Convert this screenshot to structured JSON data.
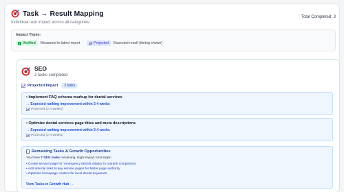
{
  "header": {
    "title": "Task → Result Mapping",
    "subtitle": "Individual task impact across all categories",
    "total_label": "Total Completed:",
    "total_value": "3"
  },
  "impact_types": {
    "label": "Impact Types:",
    "verified_badge": "Verified",
    "verified_desc": "Measured in latest report",
    "projected_badge": "Projected",
    "projected_desc": "Expected result (timing shown)"
  },
  "seo": {
    "title": "SEO",
    "subtitle": "2 tasks completed",
    "projected_label": "Projected Impact",
    "projected_count": "2 tasks",
    "tasks": [
      {
        "title": "• Implement FAQ schema markup for dental services",
        "result": "→ Expected ranking improvement within 2-4 weeks",
        "timing": "Projected (2-4 weeks)"
      },
      {
        "title": "• Optimize dental services page titles and meta descriptions",
        "result": "→ Expected ranking improvement within 2-4 weeks",
        "timing": "Projected (2-4 weeks)"
      }
    ],
    "remaining": {
      "title": "Remaining Tasks & Growth Opportunities",
      "text_prefix": "You have",
      "text_bold": "7 SEO tasks",
      "text_suffix": "remaining. High-impact next steps:",
      "items": [
        "• Create service page for 'emergency dentist ottawa' to outrank competitors",
        "• Add internal links to key service pages for better page authority",
        "• Optimize homepage content for local dental keywords"
      ],
      "link": "View Tasks in Growth Hub →"
    }
  },
  "colors": {
    "accent": "#1d4ed8",
    "verified": "#15803d",
    "projected": "#4338ca",
    "target_red": "#dc2626"
  },
  "icons": {
    "title": "target-icon",
    "seo": "target-icon",
    "verified": "check-icon",
    "projected": "chart-icon",
    "remaining": "document-icon"
  }
}
